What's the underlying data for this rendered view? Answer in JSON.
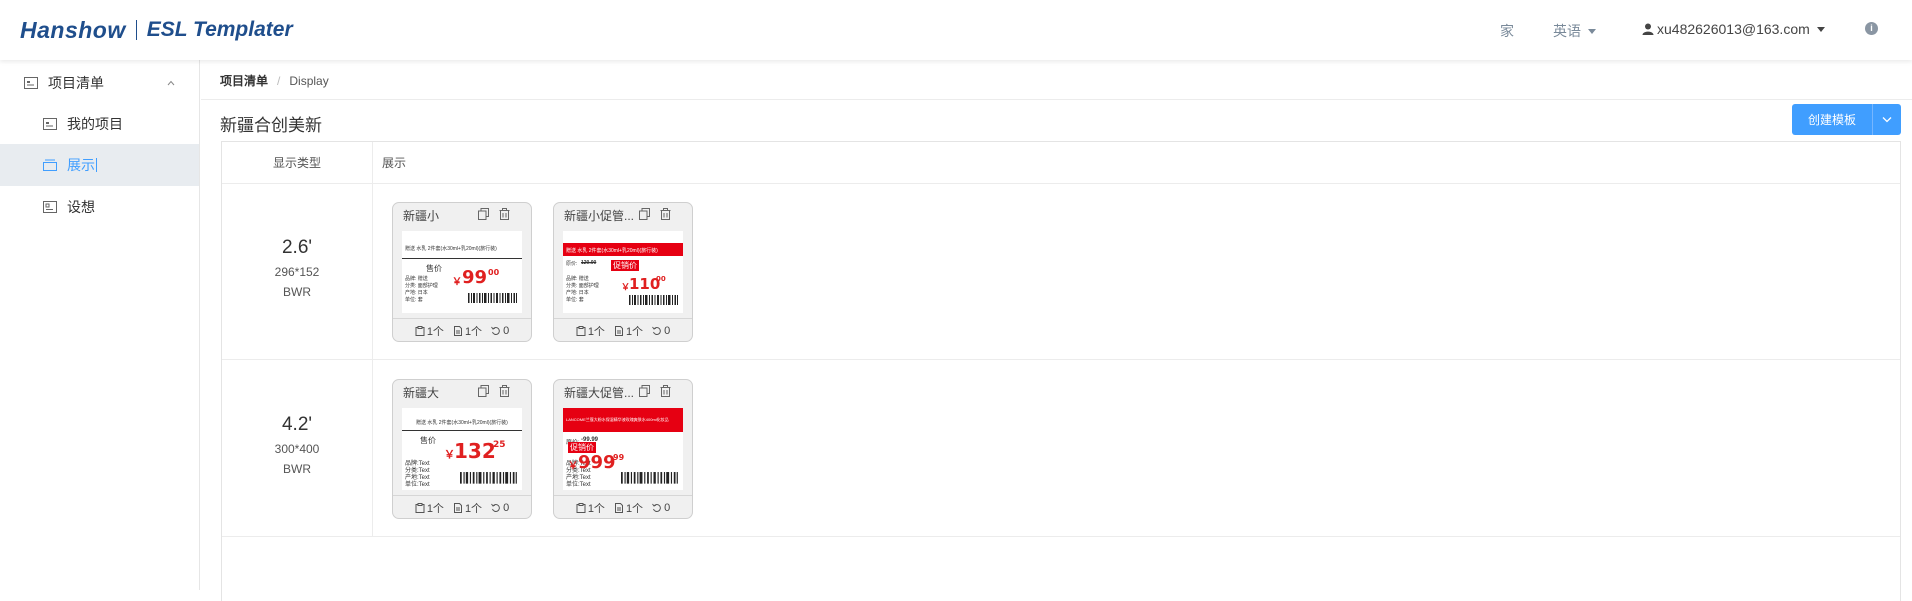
{
  "header": {
    "brand_logo": "Hanshow",
    "app_name": "ESL Templater",
    "home_label": "家",
    "lang_label": "英语",
    "user_label": "xu482626013@163.com",
    "info_icon": "i"
  },
  "sidebar": {
    "group_label": "项目清单",
    "items": [
      {
        "label": "我的项目",
        "icon": "id-card-icon"
      },
      {
        "label": "展示",
        "icon": "display-icon",
        "active": true
      },
      {
        "label": "设想",
        "icon": "settings-card-icon"
      }
    ]
  },
  "breadcrumb": {
    "root": "项目清单",
    "separator": "/",
    "current": "Display"
  },
  "page": {
    "title": "新疆合创美新",
    "create_button": "创建模板"
  },
  "table": {
    "headers": {
      "type": "显示类型",
      "show": "展示"
    },
    "rows": [
      {
        "size": "2.6'",
        "resolution": "296*152",
        "mode": "BWR",
        "cards": [
          {
            "name": "新疆小",
            "counts": [
              "1个",
              "1个",
              "0"
            ],
            "preview": {
              "header_text": "赠送 水乳 2件套(水30ml+乳20ml)(旅行装)",
              "tag": "售价",
              "currency": "￥",
              "price": "99",
              "cents": "00",
              "lines": [
                "品牌: 赠送",
                "分类: 面部护理",
                "产地: 日本",
                "单位: 套"
              ]
            }
          },
          {
            "name": "新疆小促管...",
            "counts": [
              "1个",
              "1个",
              "0"
            ],
            "preview": {
              "header_text": "赠送 水乳 2件套(水30ml+乳20ml)(旅行装)",
              "tag": "促销价",
              "orig_label": "原价:",
              "orig_price": "120.00",
              "currency": "￥",
              "price": "110",
              "cents": "00",
              "lines": [
                "品牌: 赠送",
                "分类: 面部护理",
                "产地: 日本",
                "单位: 套"
              ]
            }
          }
        ]
      },
      {
        "size": "4.2'",
        "resolution": "300*400",
        "mode": "BWR",
        "cards": [
          {
            "name": "新疆大",
            "counts": [
              "1个",
              "1个",
              "0"
            ],
            "preview": {
              "header_text": "赠送 水乳 2件套(水30ml+乳20ml)(旅行装)",
              "tag": "售价",
              "currency": "￥",
              "price": "132",
              "cents": "25",
              "lines": [
                "品牌:Text",
                "分类:Text",
                "产地:Text",
                "单位:Text"
              ]
            }
          },
          {
            "name": "新疆大促管...",
            "counts": [
              "1个",
              "1个",
              "0"
            ],
            "preview": {
              "header_text": "LANCOME兰蔻大粉水保湿精华液玫瑰爽肤水400ml化妆品",
              "tag": "促销价",
              "orig_label": "原价:",
              "orig_price": "-99.99",
              "currency": "￥",
              "price": "999",
              "cents": "99",
              "lines": [
                "品牌:Text",
                "分类:Text",
                "产地:Text",
                "单位:Text"
              ]
            }
          }
        ]
      }
    ]
  },
  "colors": {
    "accent": "#409eff",
    "brand": "#1f4e8c",
    "price_red": "#e60012"
  }
}
